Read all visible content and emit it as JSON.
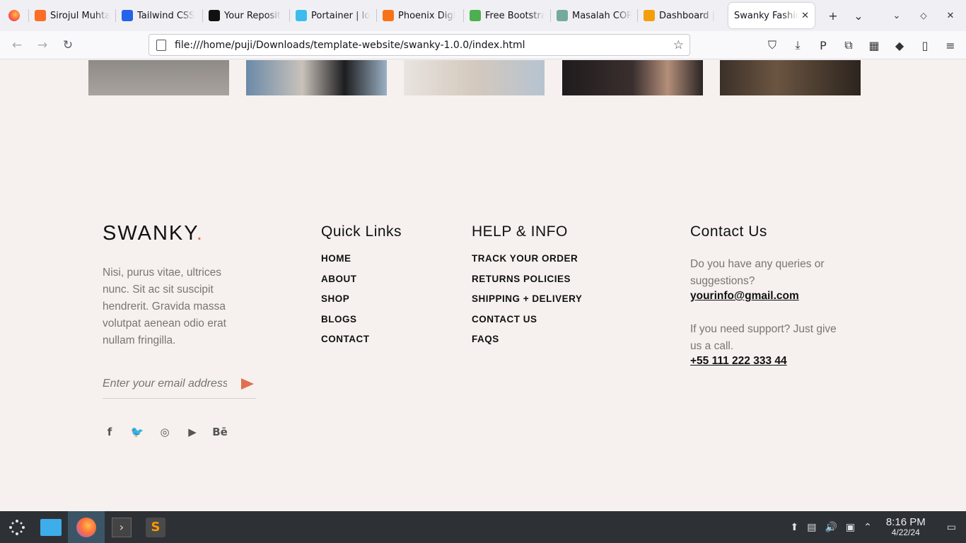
{
  "browser": {
    "tabs": [
      {
        "label": "Sirojul Muhta",
        "color": "#fc6d26"
      },
      {
        "label": "Tailwind CSS",
        "color": "#2563eb"
      },
      {
        "label": "Your Reposit",
        "color": "#111111"
      },
      {
        "label": "Portainer | lo",
        "color": "#3bbced"
      },
      {
        "label": "Phoenix Digi",
        "color": "#f97316"
      },
      {
        "label": "Free Bootstra",
        "color": "#4caf50"
      },
      {
        "label": "Masalah COR",
        "color": "#74aa9c"
      },
      {
        "label": "Dashboard |",
        "color": "#f59e0b"
      }
    ],
    "active_tab": {
      "label": "Swanky Fashio",
      "close": "✕"
    },
    "new_tab": "+",
    "tab_list": "⌄",
    "url": "file:///home/puji/Downloads/template-website/swanky-1.0.0/index.html",
    "back": "←",
    "forward": "→",
    "reload": "↻",
    "bookmark": "☆",
    "toolbar_icons": [
      "⛉",
      "⤓",
      "P",
      "⧉",
      "▦",
      "◆",
      "▯",
      "≡"
    ]
  },
  "footer": {
    "logo": "SWANKY",
    "logo_dot": ".",
    "about": "Nisi, purus vitae, ultrices nunc. Sit ac sit suscipit hendrerit. Gravida massa volutpat aenean odio erat nullam fringilla.",
    "email_placeholder": "Enter your email address",
    "socials": [
      "f",
      "🐦",
      "◎",
      "▶",
      "Bē"
    ],
    "quick_links": {
      "title": "Quick Links",
      "items": [
        "HOME",
        "ABOUT",
        "SHOP",
        "BLOGS",
        "CONTACT"
      ]
    },
    "help": {
      "title": "HELP & INFO",
      "items": [
        "TRACK YOUR ORDER",
        "RETURNS POLICIES",
        "SHIPPING + DELIVERY",
        "CONTACT US",
        "FAQS"
      ]
    },
    "contact": {
      "title": "Contact Us",
      "q1": "Do you have any queries or suggestions?",
      "email": "yourinfo@gmail.com",
      "q2": "If you need support? Just give us a call.",
      "phone": "+55 111 222 333 44"
    }
  },
  "taskbar": {
    "time": "8:16 PM",
    "date": "4/22/24"
  }
}
